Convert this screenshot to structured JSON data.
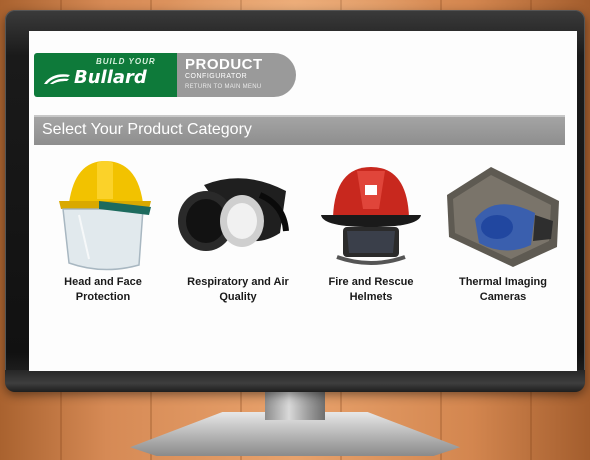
{
  "header": {
    "tagline": "BUILD YOUR",
    "brand": "Bullard",
    "product_title": "PRODUCT",
    "product_subtitle": "CONFIGURATOR",
    "return_link": "RETURN TO MAIN MENU"
  },
  "category_bar": {
    "title": "Select Your Product Category"
  },
  "products": [
    {
      "label_line1": "Head and Face",
      "label_line2": "Protection",
      "icon": "hard-hat-faceshield-icon"
    },
    {
      "label_line1": "Respiratory and Air",
      "label_line2": "Quality",
      "icon": "respirator-icon"
    },
    {
      "label_line1": "Fire and Rescue",
      "label_line2": "Helmets",
      "icon": "fire-helmet-icon"
    },
    {
      "label_line1": "Thermal Imaging",
      "label_line2": "Cameras",
      "icon": "thermal-camera-icon"
    }
  ],
  "colors": {
    "brand_green": "#0e7a3a",
    "bar_gray": "#999999",
    "wall_orange": "#d68a55"
  }
}
